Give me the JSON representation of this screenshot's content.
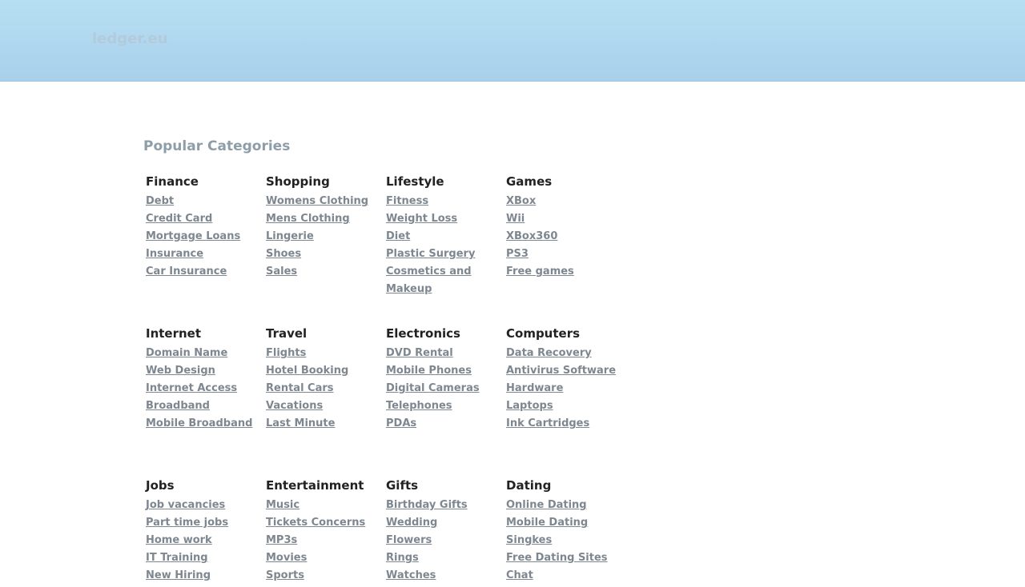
{
  "header": {
    "site_name": "ledger.eu"
  },
  "main": {
    "title": "Popular Categories",
    "categories": [
      {
        "name": "Finance",
        "links": [
          "Debt",
          "Credit Card",
          "Mortgage Loans",
          "Insurance",
          "Car Insurance"
        ]
      },
      {
        "name": "Shopping",
        "links": [
          "Womens Clothing",
          "Mens Clothing",
          "Lingerie",
          "Shoes",
          "Sales"
        ]
      },
      {
        "name": "Lifestyle",
        "links": [
          "Fitness",
          "Weight Loss",
          "Diet",
          "Plastic Surgery",
          "Cosmetics and",
          "Makeup"
        ]
      },
      {
        "name": "Games",
        "links": [
          "XBox",
          "Wii",
          "XBox360",
          "PS3",
          "Free games"
        ]
      },
      {
        "name": "Internet",
        "links": [
          "Domain Name",
          "Web Design",
          "Internet Access",
          "Broadband",
          "Mobile Broadband"
        ]
      },
      {
        "name": "Travel",
        "links": [
          "Flights",
          "Hotel Booking",
          "Rental Cars",
          "Vacations",
          "Last Minute"
        ]
      },
      {
        "name": "Electronics",
        "links": [
          "DVD Rental",
          "Mobile Phones",
          "Digital Cameras",
          "Telephones",
          "PDAs"
        ]
      },
      {
        "name": "Computers",
        "links": [
          "Data Recovery",
          "Antivirus Software",
          "Hardware",
          "Laptops",
          "Ink Cartridges"
        ]
      },
      {
        "name": "Jobs",
        "links": [
          "Job vacancies",
          "Part time jobs",
          "Home work",
          "IT Training",
          "New Hiring"
        ]
      },
      {
        "name": "Entertainment",
        "links": [
          "Music",
          "Tickets Concerns",
          "MP3s",
          "Movies",
          "Sports"
        ]
      },
      {
        "name": "Gifts",
        "links": [
          "Birthday Gifts",
          "Wedding",
          "Flowers",
          "Rings",
          "Watches"
        ]
      },
      {
        "name": "Dating",
        "links": [
          "Online Dating",
          "Mobile Dating",
          "Singkes",
          "Free Dating Sites",
          "Chat"
        ]
      }
    ]
  }
}
